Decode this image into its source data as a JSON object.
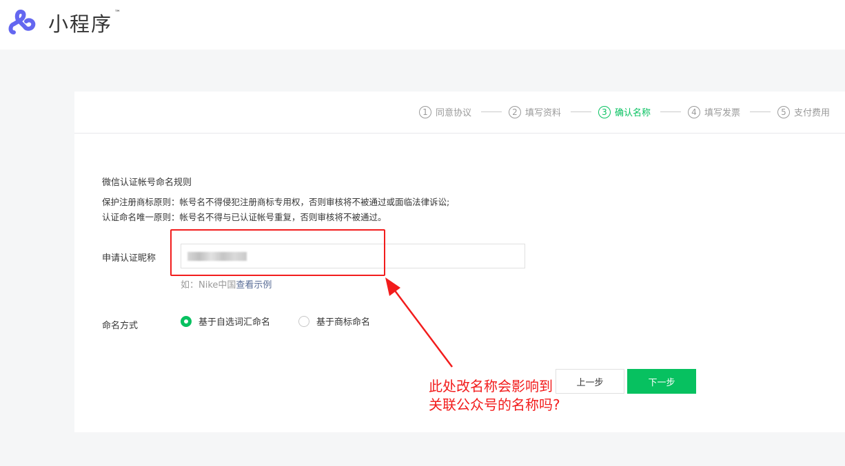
{
  "app": {
    "title": "小程序",
    "trademark": "™"
  },
  "steps": [
    {
      "num": "1",
      "label": "同意协议",
      "active": false
    },
    {
      "num": "2",
      "label": "填写资料",
      "active": false
    },
    {
      "num": "3",
      "label": "确认名称",
      "active": true
    },
    {
      "num": "4",
      "label": "填写发票",
      "active": false
    },
    {
      "num": "5",
      "label": "支付费用",
      "active": false
    }
  ],
  "rules": {
    "title": "微信认证帐号命名规则",
    "line1": "保护注册商标原则：帐号名不得侵犯注册商标专用权，否则审核将不被通过或面临法律诉讼;",
    "line2": "认证命名唯一原则：帐号名不得与已认证帐号重复，否则审核将不被通过。"
  },
  "form": {
    "nickname_label": "申请认证昵称",
    "nickname_value": "",
    "hint_prefix": "如：Nike中国",
    "hint_link": "查看示例",
    "method_label": "命名方式",
    "options": [
      {
        "label": "基于自选词汇命名",
        "checked": true
      },
      {
        "label": "基于商标命名",
        "checked": false
      }
    ]
  },
  "buttons": {
    "prev": "上一步",
    "next": "下一步"
  },
  "annotation": {
    "line1": "此处改名称会影响到",
    "line2": "关联公众号的名称吗?"
  },
  "colors": {
    "brand": "#07c160",
    "annotation": "#f21c1c",
    "logo": "#6467f0"
  }
}
